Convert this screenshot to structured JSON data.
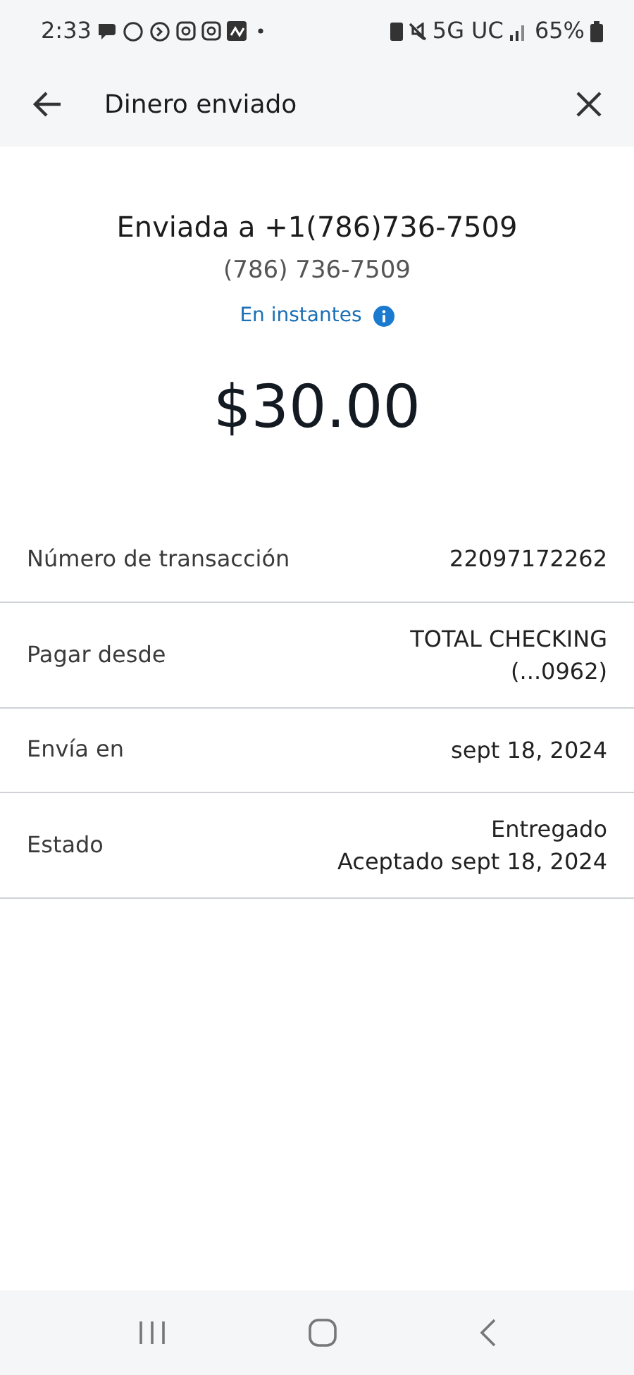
{
  "status_bar": {
    "time": "2:33",
    "network": "5G UC",
    "battery": "65%"
  },
  "header": {
    "title": "Dinero enviado"
  },
  "summary": {
    "recipient_prefix": "Enviada a",
    "recipient": "+1(786)736-7509",
    "phone": "(786) 736-7509",
    "timing": "En instantes",
    "amount": "$30.00"
  },
  "details": [
    {
      "label": "Número de transacción",
      "values": [
        "22097172262"
      ]
    },
    {
      "label": "Pagar desde",
      "values": [
        "TOTAL CHECKING",
        "(...0962)"
      ]
    },
    {
      "label": "Envía en",
      "values": [
        "sept 18, 2024"
      ]
    },
    {
      "label": "Estado",
      "values": [
        "Entregado",
        "Aceptado sept 18, 2024"
      ]
    }
  ]
}
